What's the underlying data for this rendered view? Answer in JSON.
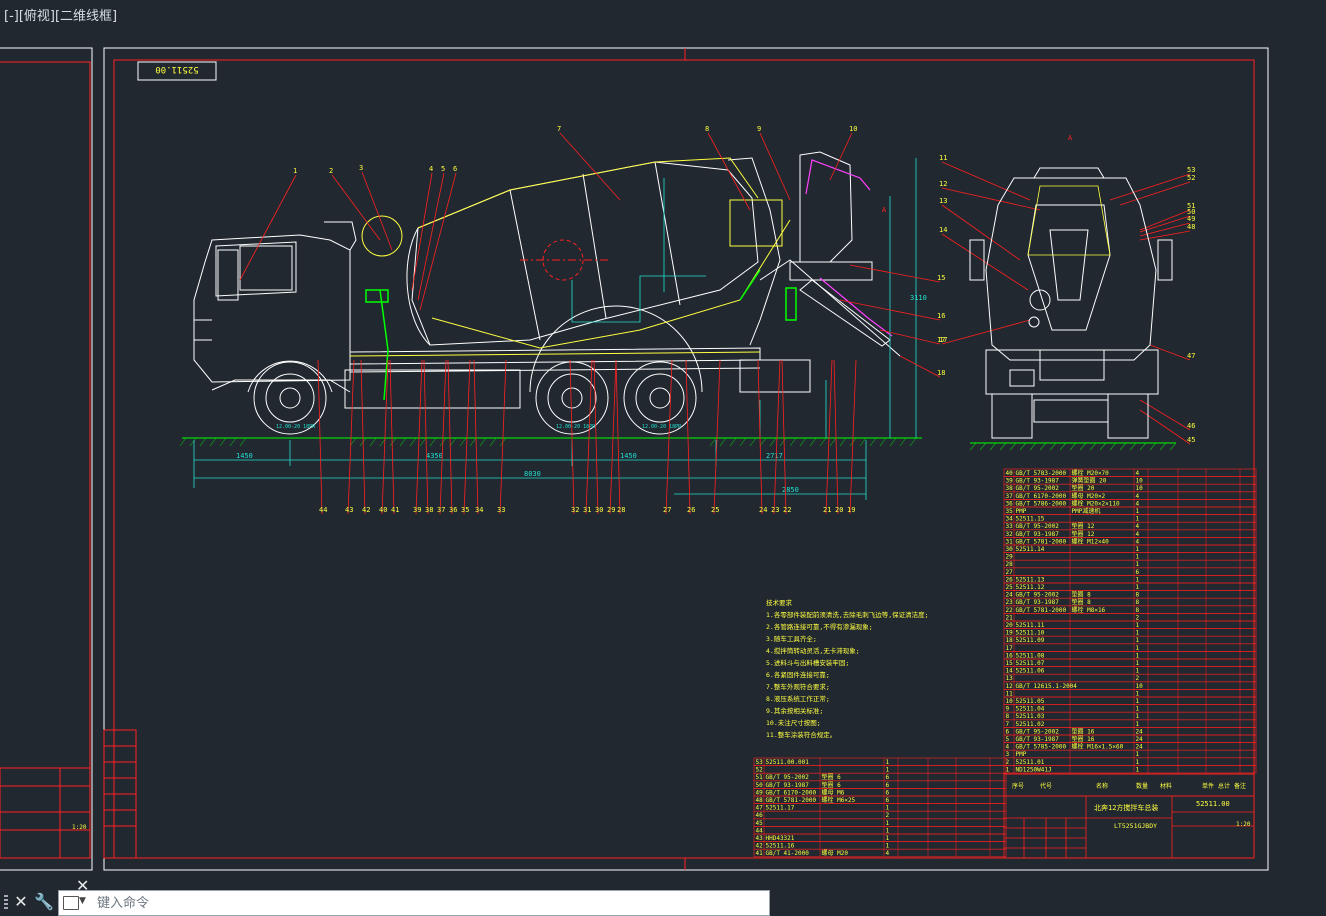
{
  "viewport": {
    "label": "[-][俯视][二维线框]"
  },
  "drawing": {
    "code_box": "52511.00",
    "balloons_top_left": [
      "1",
      "2",
      "3",
      "4",
      "5",
      "6"
    ],
    "balloons_top_mid": [
      "7",
      "8",
      "9",
      "10"
    ],
    "balloons_right": [
      "15",
      "16",
      "17",
      "18"
    ],
    "balloons_bottom": [
      "44",
      "43",
      "42",
      "40",
      "41",
      "39",
      "38",
      "37",
      "36",
      "35",
      "34",
      "33",
      "32",
      "31",
      "30",
      "29",
      "28",
      "27",
      "26",
      "25",
      "24",
      "23",
      "22",
      "21",
      "20",
      "19"
    ],
    "balloons_rear_left": [
      "11",
      "12",
      "13",
      "14",
      "17"
    ],
    "balloons_rear_right": [
      "53",
      "52",
      "51",
      "50",
      "49",
      "48",
      "47",
      "46",
      "45"
    ],
    "dimensions": [
      "1450",
      "4350",
      "1450",
      "2717",
      "8030",
      "2850",
      "3110"
    ],
    "tire_label": "12.00-20 18PR",
    "section_mark": "A"
  },
  "tech_requirements": {
    "title": "技术要求",
    "lines": [
      "1.各零部件装配前须清洗,去除毛刺飞边等,保证清洁度;",
      "2.各管路连接可靠,不得有渗漏现象;",
      "3.随车工具齐全;",
      "4.搅拌筒转动灵活,无卡滞现象;",
      "5.进料斗与出料槽安装牢固;",
      "6.各紧固件连接可靠;",
      "7.整车外观符合要求;",
      "8.液压系统工作正常;",
      "9.其余按相关标准;",
      "10.未注尺寸按图;",
      "11.整车涂装符合规定。"
    ]
  },
  "bom_right": [
    [
      "40",
      "GB/T 5783-2000",
      "螺栓 M20×70",
      "4"
    ],
    [
      "39",
      "GB/T 93-1987",
      "弹簧垫圈 20",
      "10"
    ],
    [
      "38",
      "GB/T 95-2002",
      "垫圈 20",
      "10"
    ],
    [
      "37",
      "GB/T 6170-2000",
      "螺母 M20×2",
      "4"
    ],
    [
      "36",
      "GB/T 5786-2000",
      "螺栓 M20×2×110",
      "4"
    ],
    [
      "35",
      "PMP",
      "PMP减速机",
      "1"
    ],
    [
      "34",
      "52511.15",
      "",
      "1"
    ],
    [
      "33",
      "GB/T 95-2002",
      "垫圈 12",
      "4"
    ],
    [
      "32",
      "GB/T 93-1987",
      "垫圈 12",
      "4"
    ],
    [
      "31",
      "GB/T 5781-2000",
      "螺栓 M12×40",
      "4"
    ],
    [
      "30",
      "52511.14",
      "",
      "1"
    ],
    [
      "29",
      "",
      "",
      "1"
    ],
    [
      "28",
      "",
      "",
      "1"
    ],
    [
      "27",
      "",
      "",
      "6"
    ],
    [
      "26",
      "52511.13",
      "",
      "1"
    ],
    [
      "25",
      "52511.12",
      "",
      "1"
    ],
    [
      "24",
      "GB/T 95-2002",
      "垫圈 8",
      "8"
    ],
    [
      "23",
      "GB/T 93-1987",
      "垫圈 8",
      "8"
    ],
    [
      "22",
      "GB/T 5781-2000",
      "螺栓 M8×16",
      "8"
    ],
    [
      "21",
      "",
      "",
      "2"
    ],
    [
      "20",
      "52511.11",
      "",
      "1"
    ],
    [
      "19",
      "52511.10",
      "",
      "1"
    ],
    [
      "18",
      "52511.09",
      "",
      "1"
    ],
    [
      "17",
      "",
      "",
      "1"
    ],
    [
      "16",
      "52511.08",
      "",
      "1"
    ],
    [
      "15",
      "52511.07",
      "",
      "1"
    ],
    [
      "14",
      "52511.06",
      "",
      "1"
    ],
    [
      "13",
      "",
      "",
      "2"
    ],
    [
      "12",
      "GB/T 12615.1-2004",
      "",
      "10"
    ],
    [
      "11",
      "",
      "",
      "1"
    ],
    [
      "10",
      "52511.05",
      "",
      "1"
    ],
    [
      "9",
      "52511.04",
      "",
      "1"
    ],
    [
      "8",
      "52511.03",
      "",
      "1"
    ],
    [
      "7",
      "52511.02",
      "",
      "1"
    ],
    [
      "6",
      "GB/T 95-2002",
      "垫圈 16",
      "24"
    ],
    [
      "5",
      "GB/T 93-1987",
      "垫圈 16",
      "24"
    ],
    [
      "4",
      "GB/T 5785-2000",
      "螺栓 M16×1.5×60",
      "24"
    ],
    [
      "3",
      "PMP",
      "",
      "1"
    ],
    [
      "2",
      "52511.01",
      "",
      "1"
    ],
    [
      "1",
      "ND1250W41J",
      "",
      "1"
    ]
  ],
  "bom_mid": [
    [
      "53",
      "52511.00.001",
      "",
      "1"
    ],
    [
      "52",
      "",
      "",
      "1"
    ],
    [
      "51",
      "GB/T 95-2002",
      "垫圈 6",
      "6"
    ],
    [
      "50",
      "GB/T 93-1987",
      "垫圈 6",
      "6"
    ],
    [
      "49",
      "GB/T 6170-2000",
      "螺母 M6",
      "6"
    ],
    [
      "48",
      "GB/T 5781-2000",
      "螺栓 M6×25",
      "6"
    ],
    [
      "47",
      "52511.17",
      "",
      "1"
    ],
    [
      "46",
      "",
      "",
      "2"
    ],
    [
      "45",
      "",
      "",
      "1"
    ],
    [
      "44",
      "",
      "",
      "1"
    ],
    [
      "43",
      "HHD43321",
      "",
      "1"
    ],
    [
      "42",
      "52511.16",
      "",
      "1"
    ],
    [
      "41",
      "GB/T 41-2000",
      "螺母 M20",
      "4"
    ]
  ],
  "title_block": {
    "product_name": "北奔12方搅拌车总装",
    "drawing_no": "52511.00",
    "model": "LT5251GJBDY",
    "scale": "1:20",
    "header_cols": [
      "序号",
      "代号",
      "名称",
      "数量",
      "材料",
      "单件",
      "总计",
      "备注"
    ]
  },
  "command_line": {
    "placeholder": "键入命令"
  },
  "colors": {
    "background": "#212830",
    "frame": "#ff2020",
    "drawing": "#ffffff",
    "dimension": "#22e0d0",
    "yellow": "#ffff40",
    "green": "#00ff00"
  }
}
